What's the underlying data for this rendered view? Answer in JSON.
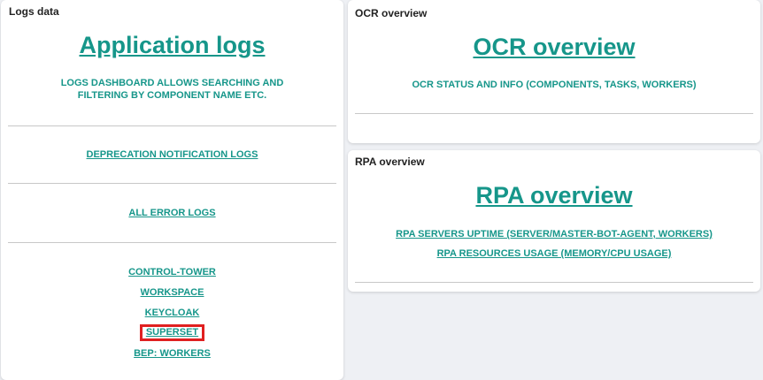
{
  "logs_panel": {
    "title": "Logs data",
    "main_link": "Application logs",
    "description_line1": "LOGS DASHBOARD ALLOWS SEARCHING AND",
    "description_line2": "FILTERING BY COMPONENT NAME ETC.",
    "deprecation_link": "DEPRECATION NOTIFICATION LOGS",
    "all_errors_link": "ALL ERROR LOGS",
    "components": [
      "CONTROL-TOWER",
      "WORKSPACE",
      "KEYCLOAK",
      "SUPERSET",
      "BEP: WORKERS"
    ]
  },
  "ocr_panel": {
    "title": "OCR overview",
    "main_link": "OCR overview",
    "description": "OCR STATUS AND INFO (COMPONENTS, TASKS, WORKERS)"
  },
  "rpa_panel": {
    "title": "RPA overview",
    "main_link": "RPA overview",
    "uptime_link": "RPA SERVERS UPTIME (SERVER/MASTER-BOT-AGENT, WORKERS)",
    "resources_link": "RPA RESOURCES USAGE (MEMORY/CPU USAGE)"
  },
  "colors": {
    "accent": "#16968a",
    "highlight": "#e02020"
  }
}
